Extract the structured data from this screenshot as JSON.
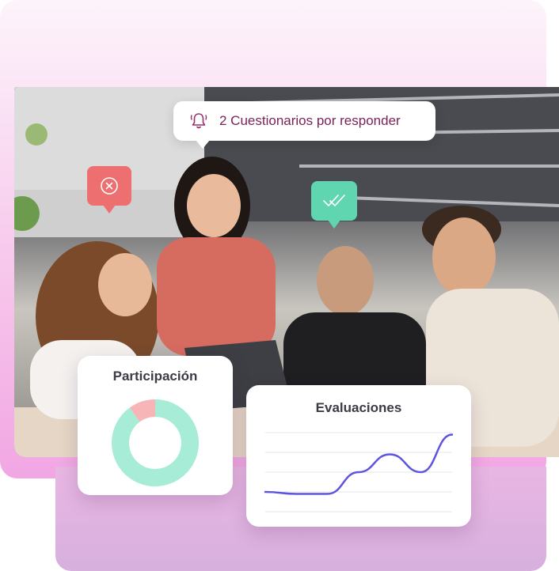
{
  "notification": {
    "icon": "bell-icon",
    "text": "2 Cuestionarios por responder"
  },
  "badges": {
    "rejected_icon": "x-circle-icon",
    "approved_icon": "double-check-icon",
    "rejected_color": "#ee6f6f",
    "approved_color": "#5fd6b0"
  },
  "participation_card": {
    "title": "Participación"
  },
  "evaluations_card": {
    "title": "Evaluaciones"
  },
  "chart_data": [
    {
      "type": "pie",
      "title": "Participación",
      "values": [
        90,
        10
      ],
      "colors": [
        "#a6ecd6",
        "#f7b5b8"
      ]
    },
    {
      "type": "line",
      "title": "Evaluaciones",
      "x": [
        0,
        1,
        2,
        3,
        4,
        5,
        6
      ],
      "series": [
        {
          "values": [
            1.0,
            0.9,
            0.9,
            2.0,
            2.9,
            2.0,
            3.9
          ],
          "color": "#5d55e0"
        }
      ],
      "ylim": [
        0,
        4
      ],
      "grid": true
    }
  ],
  "colors": {
    "accent": "#7a2357",
    "backdrop": "#f7c8ec"
  }
}
